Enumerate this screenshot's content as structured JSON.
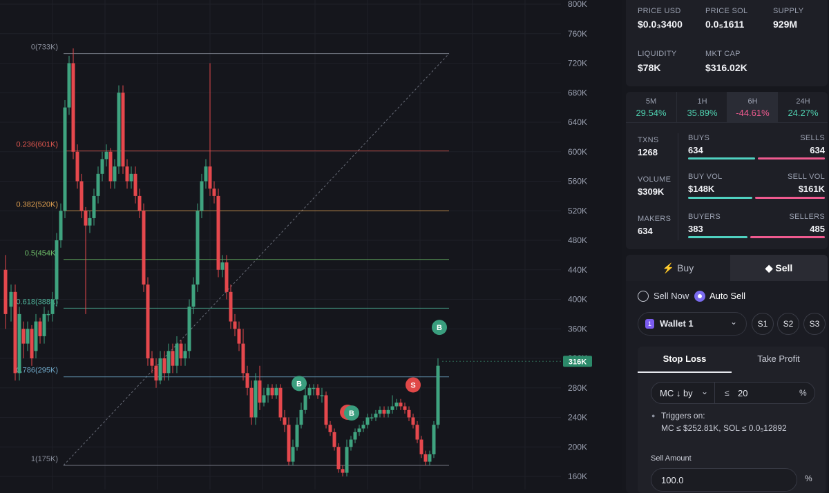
{
  "chart": {
    "price_axis": [
      "800K",
      "760K",
      "720K",
      "680K",
      "640K",
      "600K",
      "560K",
      "520K",
      "480K",
      "440K",
      "400K",
      "360K",
      "320K",
      "280K",
      "240K",
      "200K",
      "160K"
    ],
    "current_price_tag": "316K",
    "fib_levels": [
      {
        "label": "0(733K)",
        "value": 733,
        "color": "#8a8f9c"
      },
      {
        "label": "0.236(601K)",
        "value": 601,
        "color": "#e0574f"
      },
      {
        "label": "0.382(520K)",
        "value": 520,
        "color": "#e0a050"
      },
      {
        "label": "0.5(454K)",
        "value": 454,
        "color": "#6fbf6a"
      },
      {
        "label": "0.618(388K)",
        "value": 388,
        "color": "#4fb39a"
      },
      {
        "label": "0.786(295K)",
        "value": 295,
        "color": "#6fa8c8"
      },
      {
        "label": "1(175K)",
        "value": 175,
        "color": "#8a8f9c"
      }
    ],
    "markers": [
      {
        "text": "B",
        "color": "#3a9e7e",
        "price": 286,
        "time": 433
      },
      {
        "text": "S",
        "color": "#e04848",
        "price": 247,
        "time": 503
      },
      {
        "text": "B",
        "color": "#3a9e7e",
        "price": 246,
        "time": 509
      },
      {
        "text": "S",
        "color": "#e04848",
        "price": 284,
        "time": 598
      },
      {
        "text": "B",
        "color": "#3a9e7e",
        "price": 362,
        "time": 636
      }
    ],
    "candles": [
      [
        8,
        440,
        380,
        460,
        360
      ],
      [
        16,
        390,
        410,
        420,
        370
      ],
      [
        22,
        410,
        300,
        420,
        290
      ],
      [
        28,
        300,
        380,
        390,
        290
      ],
      [
        34,
        360,
        340,
        370,
        320
      ],
      [
        40,
        340,
        360,
        370,
        330
      ],
      [
        46,
        360,
        320,
        365,
        310
      ],
      [
        52,
        330,
        370,
        380,
        320
      ],
      [
        58,
        370,
        350,
        375,
        340
      ],
      [
        64,
        350,
        380,
        390,
        340
      ],
      [
        70,
        380,
        380,
        385,
        370
      ],
      [
        76,
        380,
        400,
        410,
        370
      ],
      [
        82,
        400,
        480,
        490,
        390
      ],
      [
        88,
        480,
        520,
        530,
        470
      ],
      [
        94,
        520,
        660,
        670,
        510
      ],
      [
        100,
        660,
        720,
        730,
        650
      ],
      [
        106,
        720,
        600,
        740,
        590
      ],
      [
        112,
        600,
        560,
        610,
        550
      ],
      [
        118,
        560,
        520,
        570,
        510
      ],
      [
        124,
        520,
        500,
        525,
        380
      ],
      [
        130,
        500,
        510,
        520,
        490
      ],
      [
        136,
        510,
        540,
        550,
        500
      ],
      [
        142,
        540,
        570,
        580,
        530
      ],
      [
        148,
        570,
        590,
        600,
        560
      ],
      [
        154,
        590,
        600,
        610,
        580
      ],
      [
        160,
        600,
        560,
        605,
        550
      ],
      [
        166,
        560,
        580,
        590,
        550
      ],
      [
        172,
        580,
        680,
        690,
        570
      ],
      [
        178,
        680,
        580,
        690,
        570
      ],
      [
        184,
        580,
        560,
        590,
        550
      ],
      [
        190,
        560,
        570,
        580,
        550
      ],
      [
        196,
        570,
        540,
        580,
        530
      ],
      [
        202,
        540,
        520,
        550,
        510
      ],
      [
        208,
        520,
        420,
        530,
        410
      ],
      [
        214,
        420,
        320,
        430,
        310
      ],
      [
        220,
        320,
        310,
        330,
        300
      ],
      [
        226,
        310,
        290,
        320,
        280
      ],
      [
        232,
        290,
        320,
        330,
        285
      ],
      [
        238,
        320,
        300,
        330,
        290
      ],
      [
        244,
        300,
        330,
        340,
        290
      ],
      [
        250,
        330,
        310,
        340,
        300
      ],
      [
        256,
        310,
        340,
        350,
        300
      ],
      [
        262,
        340,
        320,
        345,
        310
      ],
      [
        268,
        320,
        330,
        340,
        310
      ],
      [
        274,
        330,
        390,
        400,
        320
      ],
      [
        280,
        390,
        420,
        430,
        380
      ],
      [
        286,
        420,
        520,
        530,
        410
      ],
      [
        292,
        520,
        560,
        570,
        510
      ],
      [
        298,
        560,
        580,
        590,
        550
      ],
      [
        304,
        580,
        550,
        720,
        540
      ],
      [
        310,
        550,
        540,
        560,
        530
      ],
      [
        316,
        540,
        440,
        550,
        430
      ],
      [
        322,
        440,
        450,
        460,
        430
      ],
      [
        328,
        450,
        410,
        460,
        400
      ],
      [
        334,
        410,
        370,
        420,
        360
      ],
      [
        340,
        370,
        360,
        380,
        350
      ],
      [
        346,
        360,
        340,
        370,
        330
      ],
      [
        352,
        340,
        300,
        360,
        290
      ],
      [
        358,
        300,
        280,
        310,
        270
      ],
      [
        364,
        280,
        240,
        290,
        230
      ],
      [
        370,
        240,
        290,
        300,
        230
      ],
      [
        376,
        290,
        260,
        310,
        250
      ],
      [
        382,
        260,
        270,
        280,
        255
      ],
      [
        388,
        270,
        280,
        285,
        260
      ],
      [
        394,
        280,
        270,
        285,
        265
      ],
      [
        400,
        270,
        280,
        285,
        265
      ],
      [
        406,
        280,
        240,
        285,
        235
      ],
      [
        412,
        240,
        230,
        250,
        220
      ],
      [
        418,
        230,
        180,
        240,
        175
      ],
      [
        424,
        180,
        200,
        210,
        175
      ],
      [
        430,
        200,
        230,
        240,
        195
      ],
      [
        436,
        230,
        250,
        260,
        225
      ],
      [
        442,
        250,
        270,
        280,
        245
      ],
      [
        448,
        270,
        280,
        285,
        265
      ],
      [
        454,
        280,
        280,
        285,
        270
      ],
      [
        460,
        280,
        270,
        285,
        265
      ],
      [
        466,
        270,
        270,
        280,
        260
      ],
      [
        472,
        270,
        230,
        275,
        225
      ],
      [
        478,
        230,
        220,
        235,
        215
      ],
      [
        484,
        220,
        200,
        225,
        195
      ],
      [
        490,
        200,
        170,
        205,
        165
      ],
      [
        496,
        170,
        165,
        175,
        160
      ],
      [
        502,
        165,
        200,
        210,
        160
      ],
      [
        508,
        200,
        210,
        215,
        195
      ],
      [
        514,
        210,
        220,
        225,
        205
      ],
      [
        520,
        220,
        225,
        230,
        215
      ],
      [
        526,
        225,
        230,
        235,
        220
      ],
      [
        532,
        230,
        240,
        245,
        225
      ],
      [
        538,
        240,
        240,
        245,
        235
      ],
      [
        544,
        240,
        245,
        250,
        235
      ],
      [
        550,
        245,
        250,
        255,
        240
      ],
      [
        556,
        250,
        245,
        255,
        240
      ],
      [
        562,
        245,
        250,
        255,
        240
      ],
      [
        568,
        250,
        255,
        270,
        245
      ],
      [
        574,
        255,
        260,
        265,
        250
      ],
      [
        580,
        260,
        255,
        265,
        250
      ],
      [
        586,
        255,
        250,
        260,
        245
      ],
      [
        592,
        250,
        240,
        255,
        235
      ],
      [
        598,
        240,
        230,
        245,
        225
      ],
      [
        604,
        230,
        210,
        235,
        205
      ],
      [
        610,
        210,
        190,
        215,
        185
      ],
      [
        616,
        190,
        180,
        195,
        175
      ],
      [
        622,
        180,
        190,
        195,
        175
      ],
      [
        628,
        190,
        230,
        235,
        185
      ],
      [
        634,
        230,
        310,
        320,
        225
      ]
    ]
  },
  "stats": {
    "row1": [
      {
        "label": "PRICE USD",
        "value": "$0.0₃3400"
      },
      {
        "label": "PRICE SOL",
        "value": "0.0₅1611"
      },
      {
        "label": "SUPPLY",
        "value": "929M"
      }
    ],
    "row2": [
      {
        "label": "LIQUIDITY",
        "value": "$78K"
      },
      {
        "label": "MKT CAP",
        "value": "$316.02K"
      }
    ]
  },
  "timeframes": [
    {
      "label": "5M",
      "value": "29.54%",
      "color": "#4fd1b0"
    },
    {
      "label": "1H",
      "value": "35.89%",
      "color": "#4fd1b0"
    },
    {
      "label": "6H",
      "value": "-44.61%",
      "color": "#ef5a8f"
    },
    {
      "label": "24H",
      "value": "24.27%",
      "color": "#4fd1b0"
    }
  ],
  "activity": {
    "txns_label": "TXNS",
    "txns": "1268",
    "volume_label": "VOLUME",
    "volume": "$309K",
    "makers_label": "MAKERS",
    "makers": "634",
    "buys_label": "BUYS",
    "buys": "634",
    "sells_label": "SELLS",
    "sells": "634",
    "buyvol_label": "BUY VOL",
    "buyvol": "$148K",
    "sellvol_label": "SELL VOL",
    "sellvol": "$161K",
    "buyers_label": "BUYERS",
    "buyers": "383",
    "sellers_label": "SELLERS",
    "sellers": "485",
    "buy_ratio": 0.5,
    "buyvol_ratio": 0.479,
    "buyers_ratio": 0.441
  },
  "trade": {
    "buy_tab": "Buy",
    "sell_tab": "Sell",
    "sell_now": "Sell Now",
    "auto_sell": "Auto Sell",
    "wallet": "Wallet 1",
    "wallet_badge": "1",
    "presets": [
      "S1",
      "S2",
      "S3"
    ],
    "stop_loss": "Stop Loss",
    "take_profit": "Take Profit",
    "mc_select": "MC ↓ by",
    "le": "≤",
    "threshold": "20",
    "pct": "%",
    "triggers_title": "Triggers on:",
    "triggers_detail": "MC ≤ $252.81K, SOL ≤ 0.0₅12892",
    "sell_amount_label": "Sell Amount",
    "sell_amount": "100.0",
    "sell_amount_unit": "%"
  }
}
